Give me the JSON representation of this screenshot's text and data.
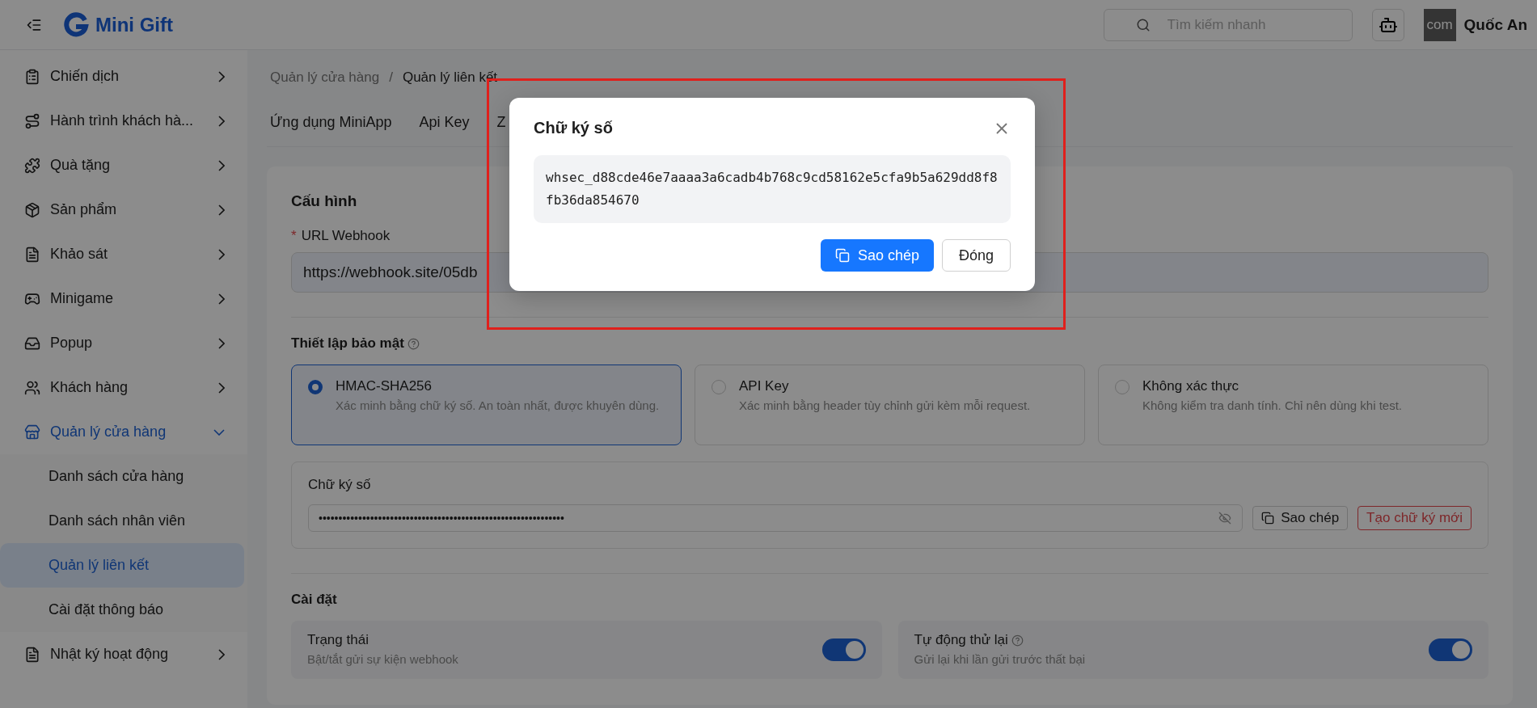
{
  "header": {
    "brand": "Mini Gift",
    "search": {
      "placeholder": "Tìm kiếm nhanh"
    },
    "avatar_text": "com",
    "user_name": "Quốc An"
  },
  "sidebar": {
    "items": [
      {
        "label": "Chiến dịch",
        "selected": false,
        "expanded": false
      },
      {
        "label": "Hành trình khách hà...",
        "selected": false,
        "expanded": false
      },
      {
        "label": "Quà tặng",
        "selected": false,
        "expanded": false
      },
      {
        "label": "Sản phẩm",
        "selected": false,
        "expanded": false
      },
      {
        "label": "Khảo sát",
        "selected": false,
        "expanded": false
      },
      {
        "label": "Minigame",
        "selected": false,
        "expanded": false
      },
      {
        "label": "Popup",
        "selected": false,
        "expanded": false
      },
      {
        "label": "Khách hàng",
        "selected": false,
        "expanded": false
      },
      {
        "label": "Quản lý cửa hàng",
        "selected": true,
        "expanded": true,
        "children": [
          {
            "label": "Danh sách cửa hàng",
            "selected": false
          },
          {
            "label": "Danh sách nhân viên",
            "selected": false
          },
          {
            "label": "Quản lý liên kết",
            "selected": true
          },
          {
            "label": "Cài đặt thông báo",
            "selected": false
          }
        ]
      },
      {
        "label": "Nhật ký hoạt động",
        "selected": false,
        "expanded": false
      }
    ]
  },
  "breadcrumb": {
    "items": [
      "Quản lý cửa hàng",
      "Quản lý liên kết"
    ],
    "separator": "/"
  },
  "tabs": [
    {
      "label": "Ứng dụng MiniApp",
      "selected": false
    },
    {
      "label": "Api Key",
      "selected": false
    },
    {
      "label": "Z",
      "selected": false
    }
  ],
  "config": {
    "title": "Cấu hình",
    "url_label": "URL Webhook",
    "required": true,
    "required_mark": "*",
    "url_value": "https://webhook.site/05db",
    "security_title": "Thiết lập bảo mật",
    "security_options": [
      {
        "title": "HMAC-SHA256",
        "description": "Xác minh bằng chữ ký số. An toàn nhất, được khuyên dùng.",
        "selected": true
      },
      {
        "title": "API Key",
        "description": "Xác minh bằng header tùy chỉnh gửi kèm mỗi request.",
        "selected": false
      },
      {
        "title": "Không xác thực",
        "description": "Không kiểm tra danh tính. Chỉ nên dùng khi test.",
        "selected": false
      }
    ],
    "signature": {
      "label": "Chữ ký số",
      "value": "••••••••••••••••••••••••••••••••••••••••••••••••••••••••••••••",
      "copy_label": "Sao chép",
      "regenerate_label": "Tạo chữ ký mới"
    },
    "settings_title": "Cài đặt",
    "settings": [
      {
        "title": "Trạng thái",
        "description": "Bật/tắt gửi sự kiện webhook",
        "help": false,
        "on": true
      },
      {
        "title": "Tự động thử lại",
        "description": "Gửi lại khi lần gửi trước thất bại",
        "help": true,
        "on": true
      }
    ]
  },
  "modal": {
    "title": "Chữ ký số",
    "code": "whsec_d88cde46e7aaaa3a6cadb4b768c9cd58162e5cfa9b5a629dd8f8fb36da854670",
    "copy_label": "Sao chép",
    "close_label": "Đóng"
  }
}
